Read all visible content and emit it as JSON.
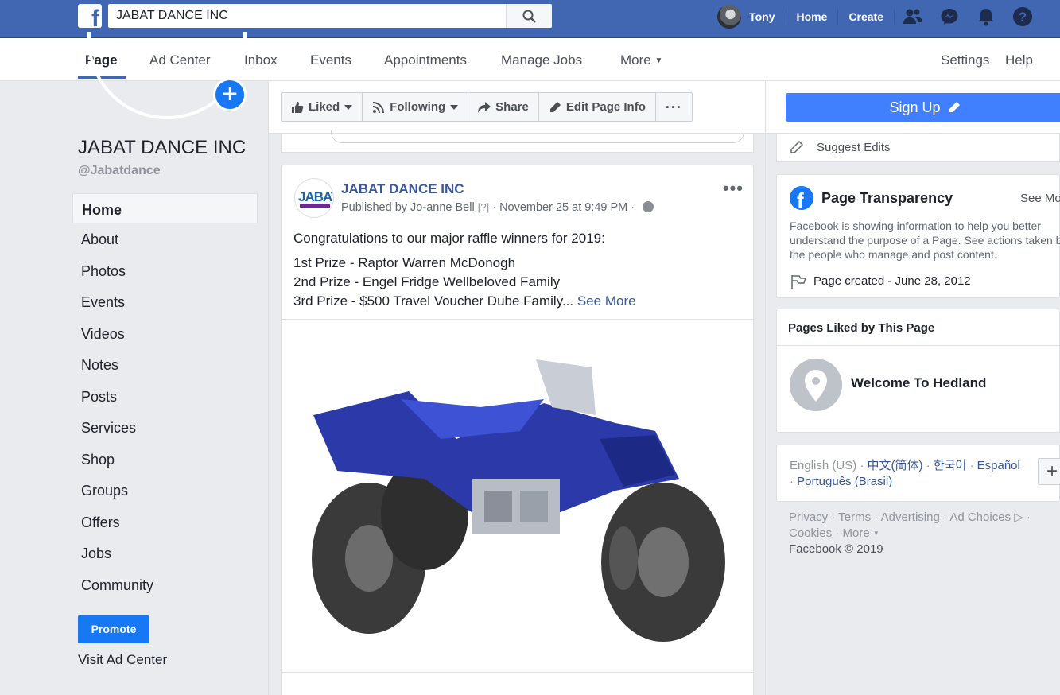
{
  "topbar": {
    "search_value": "JABAT DANCE INC",
    "user_name": "Tony",
    "home": "Home",
    "create": "Create"
  },
  "page_nav": [
    "Page",
    "Ad Center",
    "Inbox",
    "Events",
    "Appointments",
    "Manage Jobs",
    "More"
  ],
  "page_nav_right": [
    "Settings",
    "Help"
  ],
  "page": {
    "name": "JABAT DANCE INC",
    "handle": "@Jabatdance"
  },
  "left_nav": [
    "Home",
    "About",
    "Photos",
    "Events",
    "Videos",
    "Notes",
    "Posts",
    "Services",
    "Shop",
    "Groups",
    "Offers",
    "Jobs",
    "Community"
  ],
  "promote": "Promote",
  "visit_ad_center": "Visit Ad Center",
  "actions": {
    "liked": "Liked",
    "following": "Following",
    "share": "Share",
    "edit": "Edit Page Info"
  },
  "signup": "Sign Up",
  "post": {
    "author": "JABAT DANCE INC",
    "published_by": "Published by Jo-anne Bell",
    "q": "[?]",
    "date": "November 25 at 9:49 PM",
    "intro": "Congratulations to our major raffle winners for 2019:",
    "line1": "1st Prize - Raptor Warren McDonogh",
    "line2": "2nd Prize - Engel Fridge Wellbeloved Family",
    "line3": "3rd Prize - $500 Travel Voucher Dube Family...",
    "see_more": "See More",
    "logo_text": "JABAT"
  },
  "right": {
    "suggest_edits": "Suggest Edits",
    "transparency_title": "Page Transparency",
    "see_more": "See Mo",
    "transparency_desc": "Facebook is showing information to help you better understand the purpose of a Page. See actions taken by the people who manage and post content.",
    "page_created": "Page created - June 28, 2012",
    "liked_title": "Pages Liked by This Page",
    "liked_page": "Welcome To Hedland",
    "lang_current": "English (US)",
    "lang_zh": "中文(简体)",
    "lang_ko": "한국어",
    "lang_es": "Español",
    "lang_pt": "Português (Brasil)",
    "footer": {
      "privacy": "Privacy",
      "terms": "Terms",
      "advertising": "Advertising",
      "ad_choices": "Ad Choices",
      "cookies": "Cookies",
      "more": "More",
      "copyright": "Facebook © 2019"
    }
  },
  "colors": {
    "brand": "#4267b2",
    "accent": "#1877f2",
    "link": "#385898"
  }
}
